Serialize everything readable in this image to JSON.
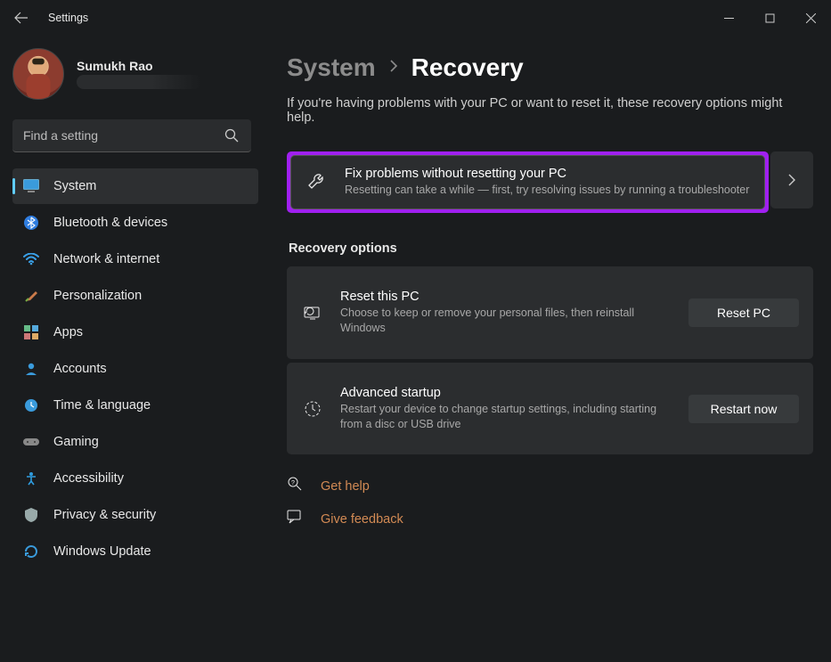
{
  "window": {
    "title": "Settings"
  },
  "user": {
    "name": "Sumukh Rao"
  },
  "search": {
    "placeholder": "Find a setting"
  },
  "sidebar": {
    "items": [
      {
        "label": "System"
      },
      {
        "label": "Bluetooth & devices"
      },
      {
        "label": "Network & internet"
      },
      {
        "label": "Personalization"
      },
      {
        "label": "Apps"
      },
      {
        "label": "Accounts"
      },
      {
        "label": "Time & language"
      },
      {
        "label": "Gaming"
      },
      {
        "label": "Accessibility"
      },
      {
        "label": "Privacy & security"
      },
      {
        "label": "Windows Update"
      }
    ]
  },
  "breadcrumb": {
    "parent": "System",
    "current": "Recovery"
  },
  "page": {
    "description": "If you're having problems with your PC or want to reset it, these recovery options might help."
  },
  "fix": {
    "title": "Fix problems without resetting your PC",
    "subtitle": "Resetting can take a while — first, try resolving issues by running a troubleshooter"
  },
  "recovery": {
    "heading": "Recovery options",
    "reset": {
      "title": "Reset this PC",
      "subtitle": "Choose to keep or remove your personal files, then reinstall Windows",
      "button": "Reset PC"
    },
    "advanced": {
      "title": "Advanced startup",
      "subtitle": "Restart your device to change startup settings, including starting from a disc or USB drive",
      "button": "Restart now"
    }
  },
  "links": {
    "help": "Get help",
    "feedback": "Give feedback"
  }
}
